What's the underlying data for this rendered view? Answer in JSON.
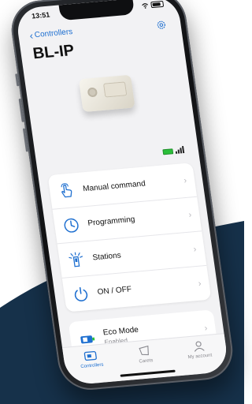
{
  "status_bar": {
    "time": "13:51"
  },
  "nav": {
    "back_label": "Controllers",
    "title": "BL-IP"
  },
  "menu": {
    "items": [
      {
        "label": "Manual command",
        "icon": "hand-tap-icon"
      },
      {
        "label": "Programming",
        "icon": "clock-icon"
      },
      {
        "label": "Stations",
        "icon": "sprinkler-icon"
      },
      {
        "label": "ON / OFF",
        "icon": "power-icon"
      }
    ]
  },
  "eco": {
    "label": "Eco Mode",
    "status": "Enabled",
    "icon": "eco-mode-icon"
  },
  "tabs": [
    {
      "label": "Controllers",
      "icon": "controller-icon",
      "active": true
    },
    {
      "label": "Carets",
      "icon": "map-icon",
      "active": false
    },
    {
      "label": "My account",
      "icon": "user-icon",
      "active": false
    }
  ],
  "colors": {
    "accent": "#1e6fd0",
    "backdrop": "#16314a",
    "battery": "#2bbf3a"
  }
}
